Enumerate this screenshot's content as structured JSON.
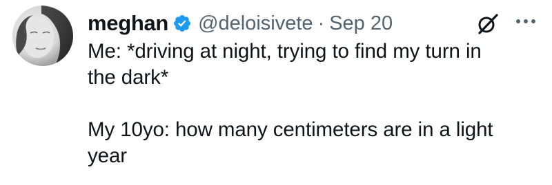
{
  "tweet": {
    "author": {
      "display_name": "meghan",
      "handle": "@deloisivete",
      "verified": true,
      "avatar_icon": "profile-photo"
    },
    "separator": "·",
    "date": "Sep 20",
    "text_lines": [
      "Me: *driving at night, trying to find my turn in",
      "the dark*",
      "",
      "My 10yo: how many centimeters are in a light",
      "year"
    ],
    "actions": {
      "grok_icon": "grok-icon",
      "more_icon": "more-options-icon"
    },
    "colors": {
      "text": "#0f1419",
      "secondary": "#536471",
      "verified_badge": "#1d9bf0"
    }
  }
}
